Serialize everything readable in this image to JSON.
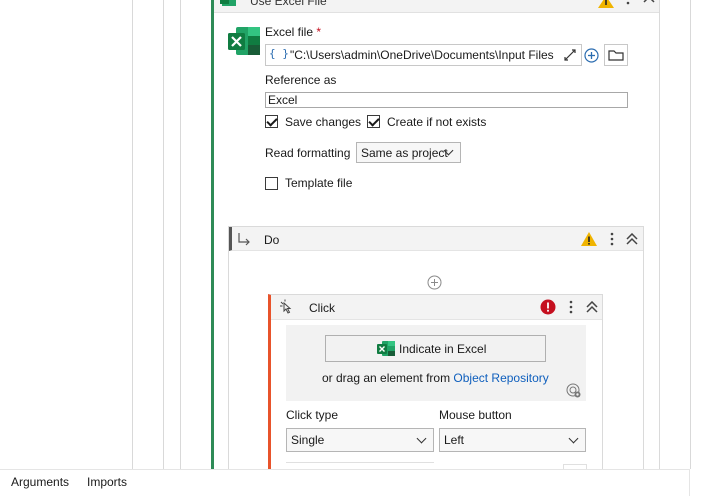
{
  "use_excel_file": {
    "title": "Use Excel File",
    "excel_file_label": "Excel file",
    "required_mark": "*",
    "path_prefix": "{ }",
    "path_value": "\"C:\\Users\\admin\\OneDrive\\Documents\\Input Files",
    "reference_label": "Reference as",
    "reference_value": "Excel",
    "save_changes_label": "Save changes",
    "save_changes_checked": true,
    "create_if_not_exists_label": "Create if not exists",
    "create_if_not_exists_checked": true,
    "read_formatting_label": "Read formatting",
    "read_formatting_value": "Same as project",
    "template_file_label": "Template file",
    "template_file_checked": false
  },
  "do_sequence": {
    "title": "Do"
  },
  "click_activity": {
    "title": "Click",
    "indicate_button_label": "Indicate in Excel",
    "drag_text": "or drag an element from",
    "object_repository_link": "Object Repository",
    "click_type_label": "Click type",
    "click_type_value": "Single",
    "mouse_button_label": "Mouse button",
    "mouse_button_value": "Left"
  },
  "bottom_tabs": {
    "arguments": "Arguments",
    "imports": "Imports"
  },
  "colors": {
    "excel_green": "#1d6f42",
    "warning": "#f0b400",
    "error": "#c50f1f",
    "link": "#0f5fbd",
    "click_accent": "#e8532b"
  }
}
